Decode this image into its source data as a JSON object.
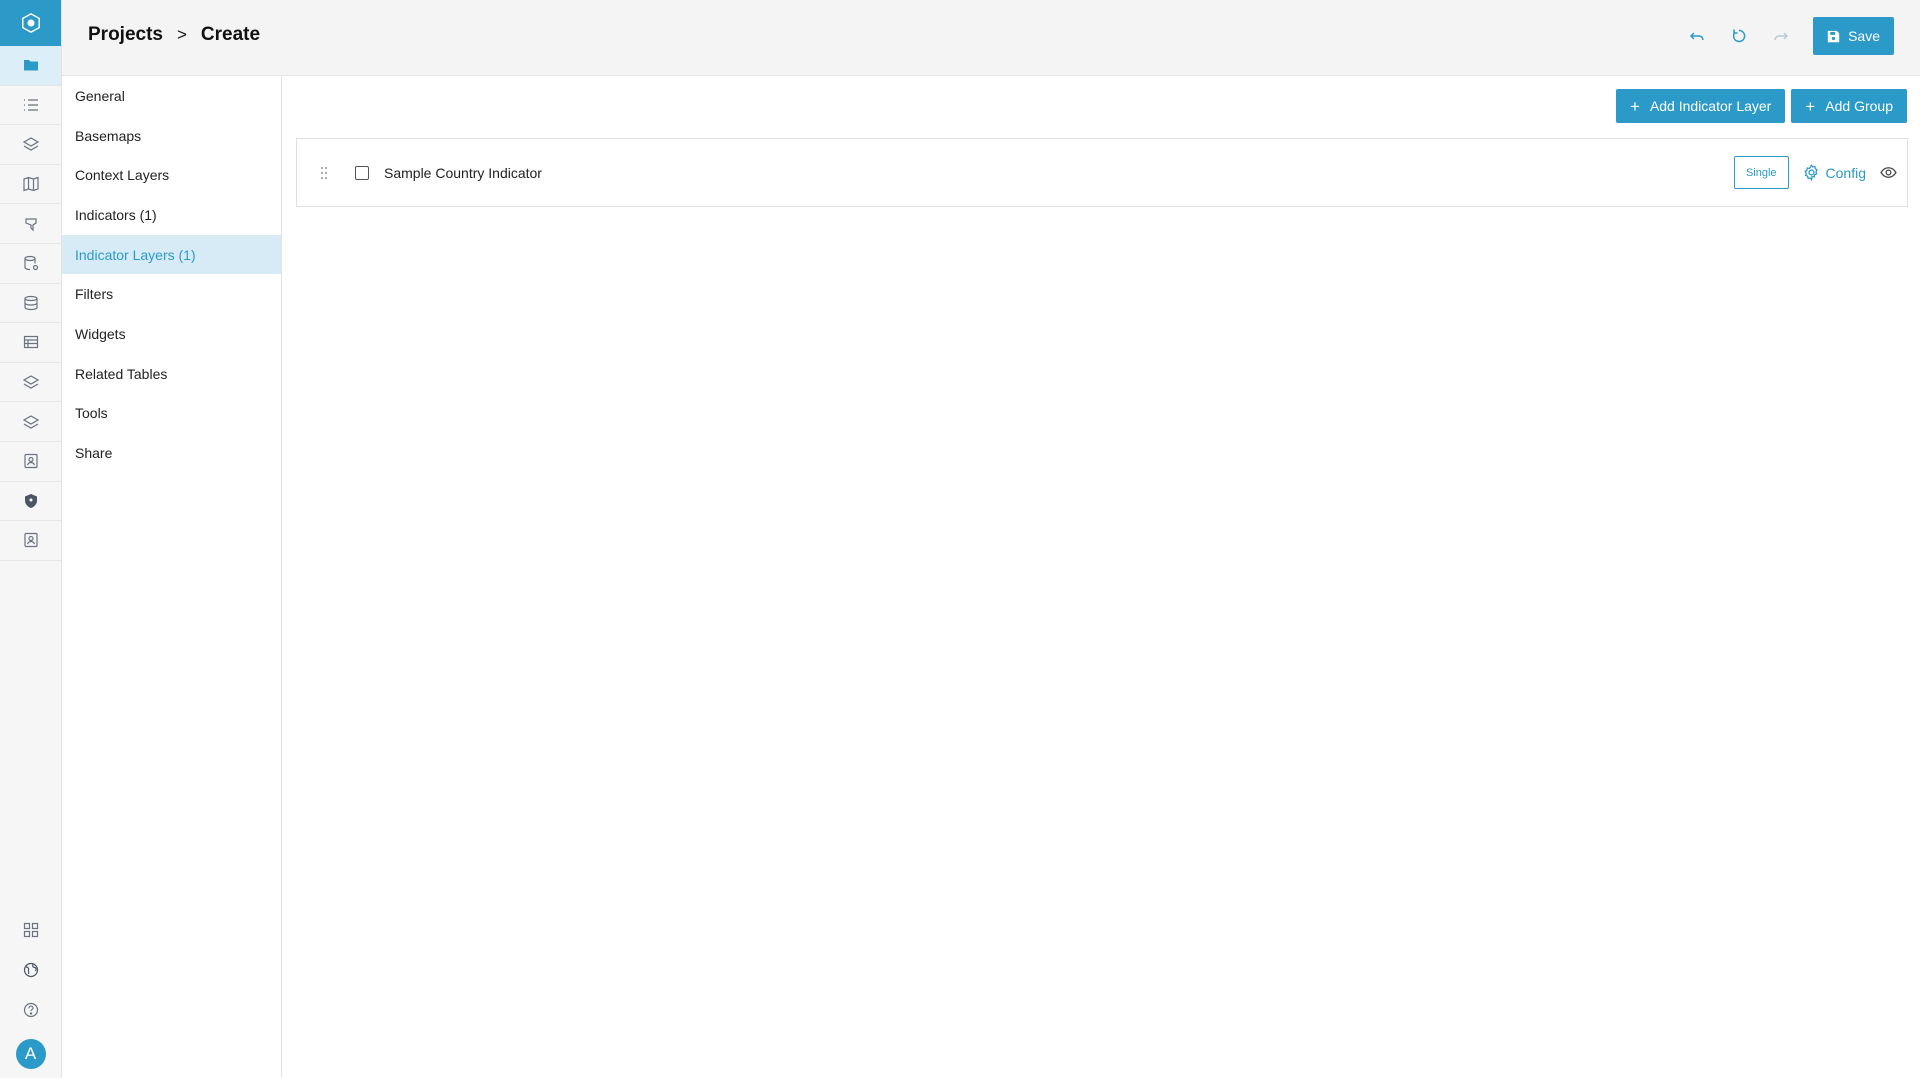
{
  "header": {
    "breadcrumb": [
      "Projects",
      "Create"
    ],
    "separator": ">",
    "save_label": "Save"
  },
  "rail": {
    "top_icons": [
      "folder-icon",
      "list-icon",
      "layers-icon",
      "map-icon",
      "pin-icon",
      "database-settings-icon",
      "database-icon",
      "table-icon",
      "layers-icon",
      "layers-icon",
      "contact-icon",
      "shield-icon",
      "contact-icon"
    ],
    "bottom_icons": [
      "grid-icon",
      "globe-icon",
      "help-icon"
    ],
    "avatar_letter": "A"
  },
  "sidebar": {
    "items": [
      {
        "label": "General"
      },
      {
        "label": "Basemaps"
      },
      {
        "label": "Context Layers"
      },
      {
        "label": "Indicators (1)"
      },
      {
        "label": "Indicator Layers (1)",
        "active": true
      },
      {
        "label": "Filters"
      },
      {
        "label": "Widgets"
      },
      {
        "label": "Related Tables"
      },
      {
        "label": "Tools"
      },
      {
        "label": "Share"
      }
    ]
  },
  "main": {
    "add_layer_label": "Add Indicator Layer",
    "add_group_label": "Add Group",
    "layers": [
      {
        "name": "Sample Country Indicator",
        "type_label": "Single",
        "config_label": "Config"
      }
    ]
  },
  "colors": {
    "accent": "#2b9ac8",
    "active_bg": "#d7ebf6"
  }
}
